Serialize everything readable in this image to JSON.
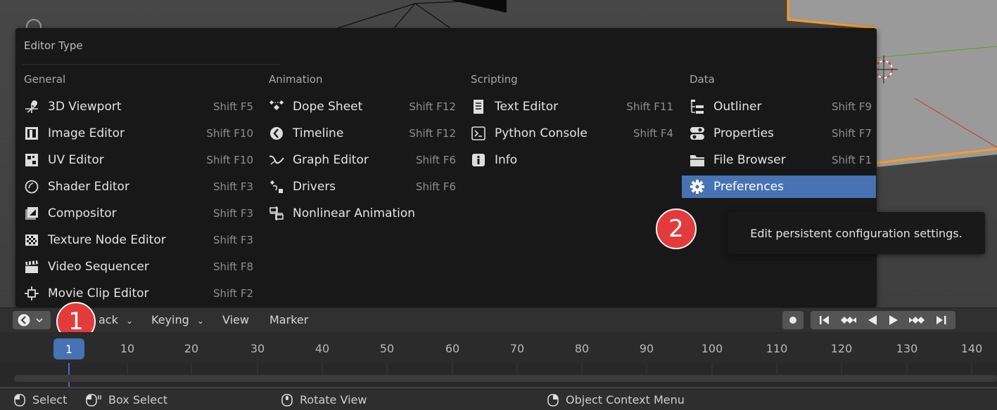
{
  "menu": {
    "title": "Editor Type",
    "columns": [
      {
        "heading": "General",
        "items": [
          {
            "icon": "3d-viewport-icon",
            "label": "3D Viewport",
            "shortcut": "Shift F5"
          },
          {
            "icon": "image-editor-icon",
            "label": "Image Editor",
            "shortcut": "Shift F10"
          },
          {
            "icon": "uv-editor-icon",
            "label": "UV Editor",
            "shortcut": "Shift F10"
          },
          {
            "icon": "shader-editor-icon",
            "label": "Shader Editor",
            "shortcut": "Shift F3"
          },
          {
            "icon": "compositor-icon",
            "label": "Compositor",
            "shortcut": "Shift F3"
          },
          {
            "icon": "texture-node-editor-icon",
            "label": "Texture Node Editor",
            "shortcut": "Shift F3"
          },
          {
            "icon": "video-sequencer-icon",
            "label": "Video Sequencer",
            "shortcut": "Shift F8"
          },
          {
            "icon": "movie-clip-editor-icon",
            "label": "Movie Clip Editor",
            "shortcut": "Shift F2"
          }
        ]
      },
      {
        "heading": "Animation",
        "items": [
          {
            "icon": "dope-sheet-icon",
            "label": "Dope Sheet",
            "shortcut": "Shift F12"
          },
          {
            "icon": "timeline-icon",
            "label": "Timeline",
            "shortcut": "Shift F12"
          },
          {
            "icon": "graph-editor-icon",
            "label": "Graph Editor",
            "shortcut": "Shift F6"
          },
          {
            "icon": "drivers-icon",
            "label": "Drivers",
            "shortcut": "Shift F6"
          },
          {
            "icon": "nonlinear-animation-icon",
            "label": "Nonlinear Animation",
            "shortcut": ""
          }
        ]
      },
      {
        "heading": "Scripting",
        "items": [
          {
            "icon": "text-editor-icon",
            "label": "Text Editor",
            "shortcut": "Shift F11"
          },
          {
            "icon": "python-console-icon",
            "label": "Python Console",
            "shortcut": "Shift F4"
          },
          {
            "icon": "info-icon",
            "label": "Info",
            "shortcut": ""
          }
        ]
      },
      {
        "heading": "Data",
        "items": [
          {
            "icon": "outliner-icon",
            "label": "Outliner",
            "shortcut": "Shift F9"
          },
          {
            "icon": "properties-icon",
            "label": "Properties",
            "shortcut": "Shift F7"
          },
          {
            "icon": "file-browser-icon",
            "label": "File Browser",
            "shortcut": "Shift F1"
          },
          {
            "icon": "preferences-icon",
            "label": "Preferences",
            "shortcut": "",
            "selected": true
          }
        ]
      }
    ],
    "tooltip": "Edit persistent configuration settings."
  },
  "callouts": {
    "one": "1",
    "two": "2"
  },
  "timeline_header": {
    "playback_partial": "ack",
    "keying": "Keying",
    "view": "View",
    "marker": "Marker"
  },
  "timeline": {
    "current_frame": "1",
    "frame_labels": [
      "10",
      "20",
      "30",
      "40",
      "50",
      "60",
      "70",
      "80",
      "90",
      "100",
      "110",
      "120",
      "130",
      "140"
    ]
  },
  "status_bar": {
    "select": "Select",
    "box_select": "Box Select",
    "rotate_view": "Rotate View",
    "context_menu": "Object Context Menu"
  },
  "colors": {
    "accent": "#4772b3",
    "badge": "#e33b3b",
    "selection_outline": "#ff9a1f"
  }
}
